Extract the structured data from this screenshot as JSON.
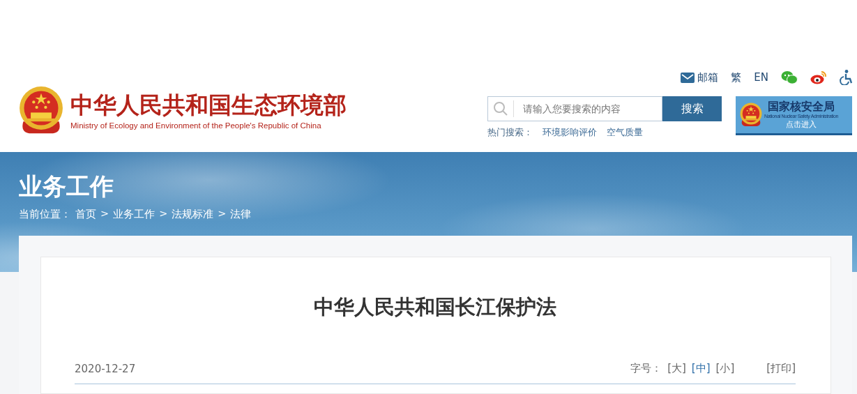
{
  "header": {
    "title": "中华人民共和国生态环境部",
    "subtitle": "Ministry of Ecology and Environment of the People's Republic of China",
    "top_links": [
      {
        "kind": "mail",
        "label": "邮箱"
      },
      {
        "kind": "text",
        "label": "繁"
      },
      {
        "kind": "text",
        "label": "EN"
      },
      {
        "kind": "wechat"
      },
      {
        "kind": "weibo"
      },
      {
        "kind": "accessibility"
      }
    ],
    "search": {
      "placeholder": "请输入您要搜索的内容",
      "button": "搜索"
    },
    "hot_search": {
      "label": "热门搜索：",
      "items": [
        "环境影响评价",
        "空气质量"
      ]
    },
    "partner": {
      "title": "国家核安全局",
      "subtitle": "National Nuclear Safety Administration",
      "action": "点击进入"
    }
  },
  "banner": {
    "title": "业务工作",
    "breadcrumb": {
      "label": "当前位置：",
      "separator": ">",
      "items": [
        "首页",
        "业务工作",
        "法规标准",
        "法律"
      ]
    }
  },
  "article": {
    "title": "中华人民共和国长江保护法",
    "date": "2020-12-27",
    "font_size": {
      "label": "字号：",
      "options": [
        {
          "label": "[大]",
          "selected": false
        },
        {
          "label": "[中]",
          "selected": true
        },
        {
          "label": "[小]",
          "selected": false
        }
      ]
    },
    "print": "[打印]"
  }
}
